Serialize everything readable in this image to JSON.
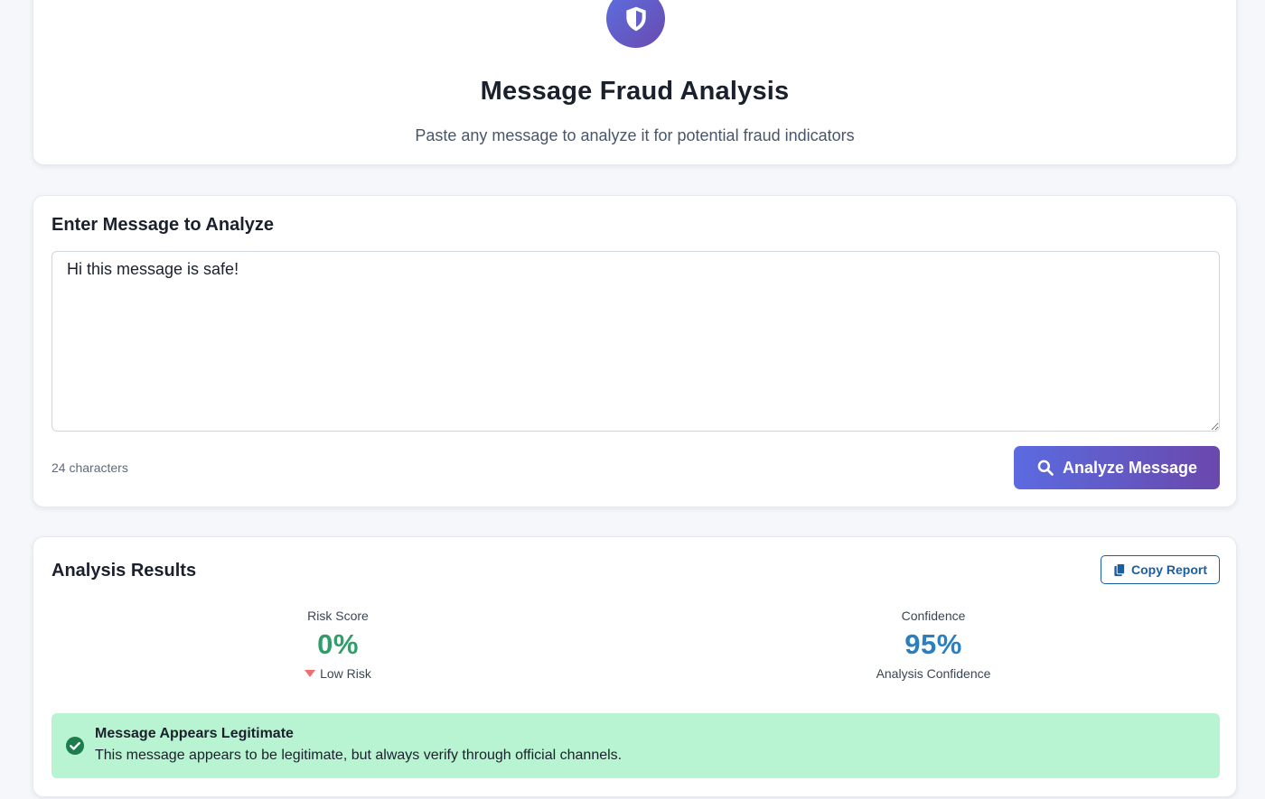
{
  "header": {
    "title": "Message Fraud Analysis",
    "subtitle": "Paste any message to analyze it for potential fraud indicators",
    "icon": "shield-icon"
  },
  "input_section": {
    "title": "Enter Message to Analyze",
    "message_value": "Hi this message is safe!",
    "char_count": "24 characters",
    "analyze_label": "Analyze Message",
    "analyze_icon": "search-icon"
  },
  "results": {
    "title": "Analysis Results",
    "copy_label": "Copy Report",
    "copy_icon": "copy-icon",
    "risk": {
      "label": "Risk Score",
      "value": "0%",
      "level": "Low Risk",
      "level_icon": "down-triangle-icon"
    },
    "confidence": {
      "label": "Confidence",
      "value": "95%",
      "sub": "Analysis Confidence"
    },
    "alert": {
      "title": "Message Appears Legitimate",
      "text": "This message appears to be legitimate, but always verify through official channels.",
      "icon": "check-circle-icon"
    }
  },
  "colors": {
    "accent_gradient_start": "#5b6be0",
    "accent_gradient_end": "#6a48ac",
    "risk_value": "#2e9e6b",
    "confidence_value": "#2a7fc0",
    "alert_background": "#b9f4d2",
    "alert_icon": "#1e7d4e",
    "copy_button": "#1c5fa0"
  }
}
